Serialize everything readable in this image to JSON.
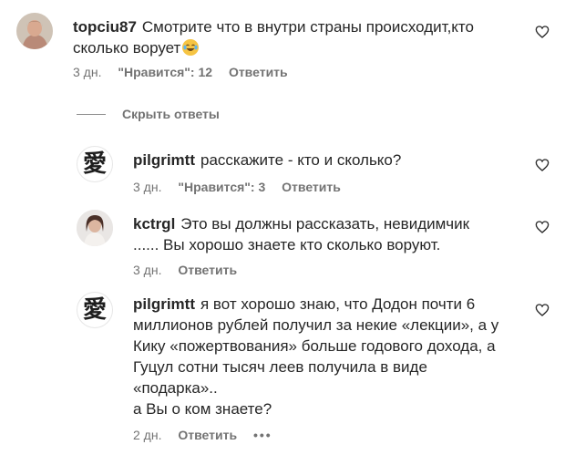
{
  "comments": [
    {
      "username": "topciu87",
      "text": "Смотрите что в внутри страны происходит,кто сколько ворует",
      "emoji_icon": "laughing-with-tears-emoji",
      "time": "3 дн.",
      "likes": "\"Нравится\": 12",
      "reply": "Ответить"
    },
    {
      "username": "pilgrimtt",
      "avatar_glyph": "愛",
      "text": "расскажите - кто и сколько?",
      "time": "3 дн.",
      "likes": "\"Нравится\": 3",
      "reply": "Ответить"
    },
    {
      "username": "kctrgl",
      "text": "Это вы должны рассказать, невидимчик ...... Вы хорошо знаете кто сколько воруют.",
      "time": "3 дн.",
      "reply": "Ответить"
    },
    {
      "username": "pilgrimtt",
      "avatar_glyph": "愛",
      "text_lines": [
        "я вот хорошо знаю, что Додон почти 6",
        "миллионов рублей получил за некие «лекции», а у",
        "Кику «пожертвования» больше годового дохода, а",
        "Гуцул сотни тысяч леев получила в виде",
        "«подарка»..",
        "а Вы о ком знаете?"
      ],
      "time": "2 дн.",
      "reply": "Ответить",
      "more": "•••"
    }
  ],
  "hide_replies": "Скрыть ответы",
  "icons": {
    "like": "heart-outline-icon",
    "more": "more-options-icon"
  },
  "colors": {
    "text": "#262626",
    "meta": "#737373",
    "emoji": "#f6c443"
  }
}
